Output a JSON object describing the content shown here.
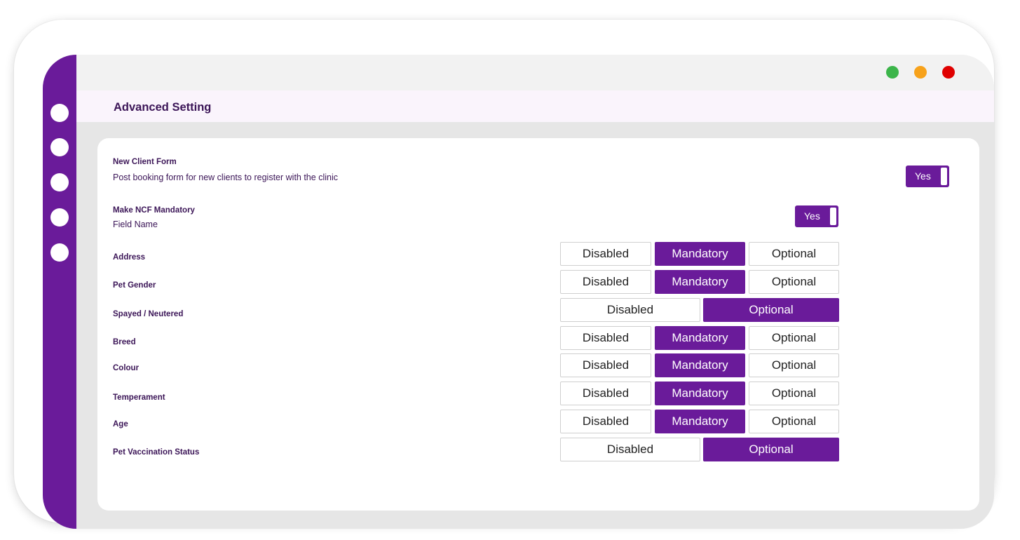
{
  "colors": {
    "accent": "#6a1b9a",
    "header_bg": "#faf4fc",
    "window_green": "#3cb54a",
    "window_orange": "#f7a21b",
    "window_red": "#e00000"
  },
  "sidebar": {
    "items": [
      "nav-dot-1",
      "nav-dot-2",
      "nav-dot-3",
      "nav-dot-4",
      "nav-dot-5"
    ]
  },
  "header": {
    "title": "Advanced Setting"
  },
  "new_client_form": {
    "label": "New Client Form",
    "description": "Post booking form for new clients to register with the clinic",
    "toggle_label": "Yes"
  },
  "make_ncf_mandatory": {
    "label": "Make NCF Mandatory",
    "sub_label": "Field Name",
    "toggle_label": "Yes"
  },
  "options": {
    "disabled": "Disabled",
    "mandatory": "Mandatory",
    "optional": "Optional"
  },
  "fields": [
    {
      "name": "Address",
      "selected": "Mandatory"
    },
    {
      "name": "Pet Gender",
      "selected": "Mandatory"
    },
    {
      "name": "Spayed / Neutered",
      "selected": "Optional"
    },
    {
      "name": "Breed",
      "selected": "Mandatory"
    },
    {
      "name": "Colour",
      "selected": "Mandatory"
    },
    {
      "name": "Temperament",
      "selected": "Mandatory"
    },
    {
      "name": "Age",
      "selected": "Mandatory"
    },
    {
      "name": "Pet Vaccination Status",
      "selected": "Optional"
    }
  ]
}
